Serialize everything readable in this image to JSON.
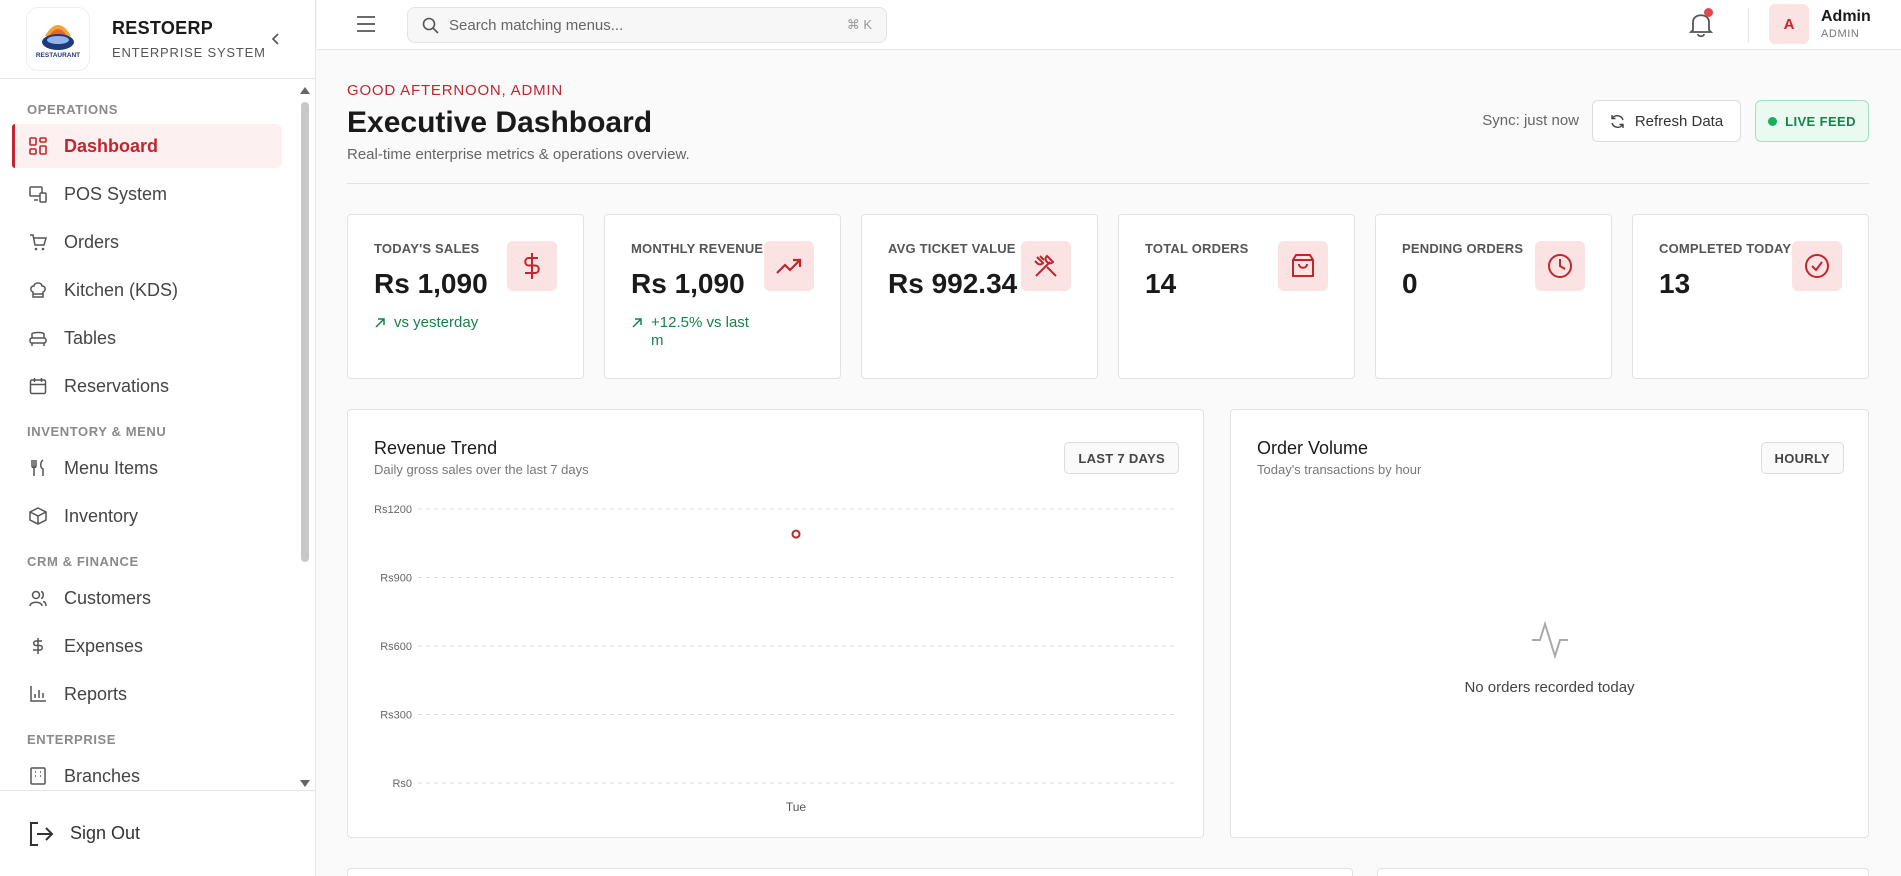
{
  "brand": {
    "name": "RESTOERP",
    "subtitle": "ENTERPRISE SYSTEM",
    "logo_text": "RESTAURANT"
  },
  "nav": {
    "sections": [
      {
        "label": "OPERATIONS",
        "items": [
          "Dashboard",
          "POS System",
          "Orders",
          "Kitchen (KDS)",
          "Tables",
          "Reservations"
        ]
      },
      {
        "label": "INVENTORY & MENU",
        "items": [
          "Menu Items",
          "Inventory"
        ]
      },
      {
        "label": "CRM & FINANCE",
        "items": [
          "Customers",
          "Expenses",
          "Reports"
        ]
      },
      {
        "label": "ENTERPRISE",
        "items": [
          "Branches"
        ]
      }
    ],
    "active": "Dashboard"
  },
  "signout_label": "Sign Out",
  "search": {
    "placeholder": "Search matching menus...",
    "shortcut": "⌘ K"
  },
  "user": {
    "initial": "A",
    "name": "Admin",
    "role": "ADMIN"
  },
  "header": {
    "greeting": "GOOD AFTERNOON, ADMIN",
    "title": "Executive Dashboard",
    "subtitle": "Real-time enterprise metrics & operations overview.",
    "sync": "Sync: just now",
    "refresh_label": "Refresh Data",
    "live_label": "LIVE FEED"
  },
  "kpis": [
    {
      "label": "TODAY'S SALES",
      "value": "Rs 1,090",
      "trend": "vs yesterday",
      "icon": "dollar-icon"
    },
    {
      "label": "MONTHLY REVENUE",
      "value": "Rs 1,090",
      "trend": "+12.5% vs last m",
      "icon": "trending-up-icon"
    },
    {
      "label": "AVG TICKET VALUE",
      "value": "Rs 992.34",
      "trend": "",
      "icon": "utensils-crossed-icon"
    },
    {
      "label": "TOTAL ORDERS",
      "value": "14",
      "trend": "",
      "icon": "shopping-bag-icon"
    },
    {
      "label": "PENDING ORDERS",
      "value": "0",
      "trend": "",
      "icon": "clock-icon"
    },
    {
      "label": "COMPLETED TODAY",
      "value": "13",
      "trend": "",
      "icon": "check-circle-icon"
    }
  ],
  "revenue_card": {
    "title": "Revenue Trend",
    "subtitle": "Daily gross sales over the last 7 days",
    "chip": "LAST 7 DAYS"
  },
  "order_card": {
    "title": "Order Volume",
    "subtitle": "Today's transactions by hour",
    "chip": "HOURLY",
    "empty_text": "No orders recorded today"
  },
  "colors": {
    "accent": "#c0262d",
    "accent_soft": "#fbe3e4",
    "success": "#17824a"
  },
  "chart_data": {
    "type": "line",
    "title": "Revenue Trend",
    "categories": [
      "Tue"
    ],
    "values": [
      1090
    ],
    "y_ticks": [
      "Rs0",
      "Rs300",
      "Rs600",
      "Rs900",
      "Rs1200"
    ],
    "ylim": [
      0,
      1200
    ],
    "grid": true
  }
}
